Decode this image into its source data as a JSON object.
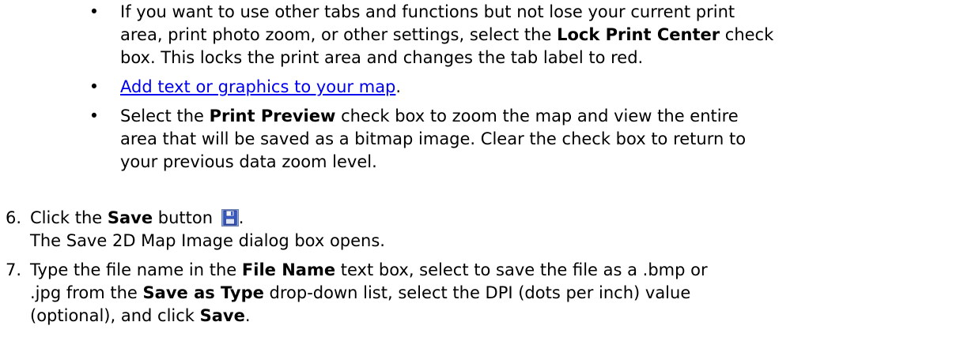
{
  "bullets": [
    {
      "line1": "If you want to use other tabs and functions but not lose your current print",
      "line2_a": "area, print photo zoom, or other settings, select the ",
      "line2_b": "Lock Print Center",
      "line2_c": " check",
      "line3": "box. This locks the print area and changes the tab label to red."
    },
    {
      "link_text": "Add text or graphics to your map",
      "after": "."
    },
    {
      "line1_a": "Select the ",
      "line1_b": "Print Preview",
      "line1_c": " check box to zoom the map and view the entire",
      "line2": "area that will be saved as a bitmap image. Clear the check box to return to",
      "line3": "your previous data zoom level."
    }
  ],
  "steps": [
    {
      "num": "6.",
      "line1_a": "Click the ",
      "line1_b": "Save",
      "line1_c": " button ",
      "line1_d": ".",
      "icon": "save-icon",
      "line2": "The Save 2D Map Image dialog box opens."
    },
    {
      "num": "7.",
      "line1_a": "Type the file name in the ",
      "line1_b": "File Name",
      "line1_c": " text box, select to save the file as a .bmp or",
      "line2_a": ".jpg from the ",
      "line2_b": "Save as Type",
      "line2_c": " drop-down list, select the DPI (dots per inch) value",
      "line3_a": "(optional), and click ",
      "line3_b": "Save",
      "line3_c": "."
    }
  ]
}
